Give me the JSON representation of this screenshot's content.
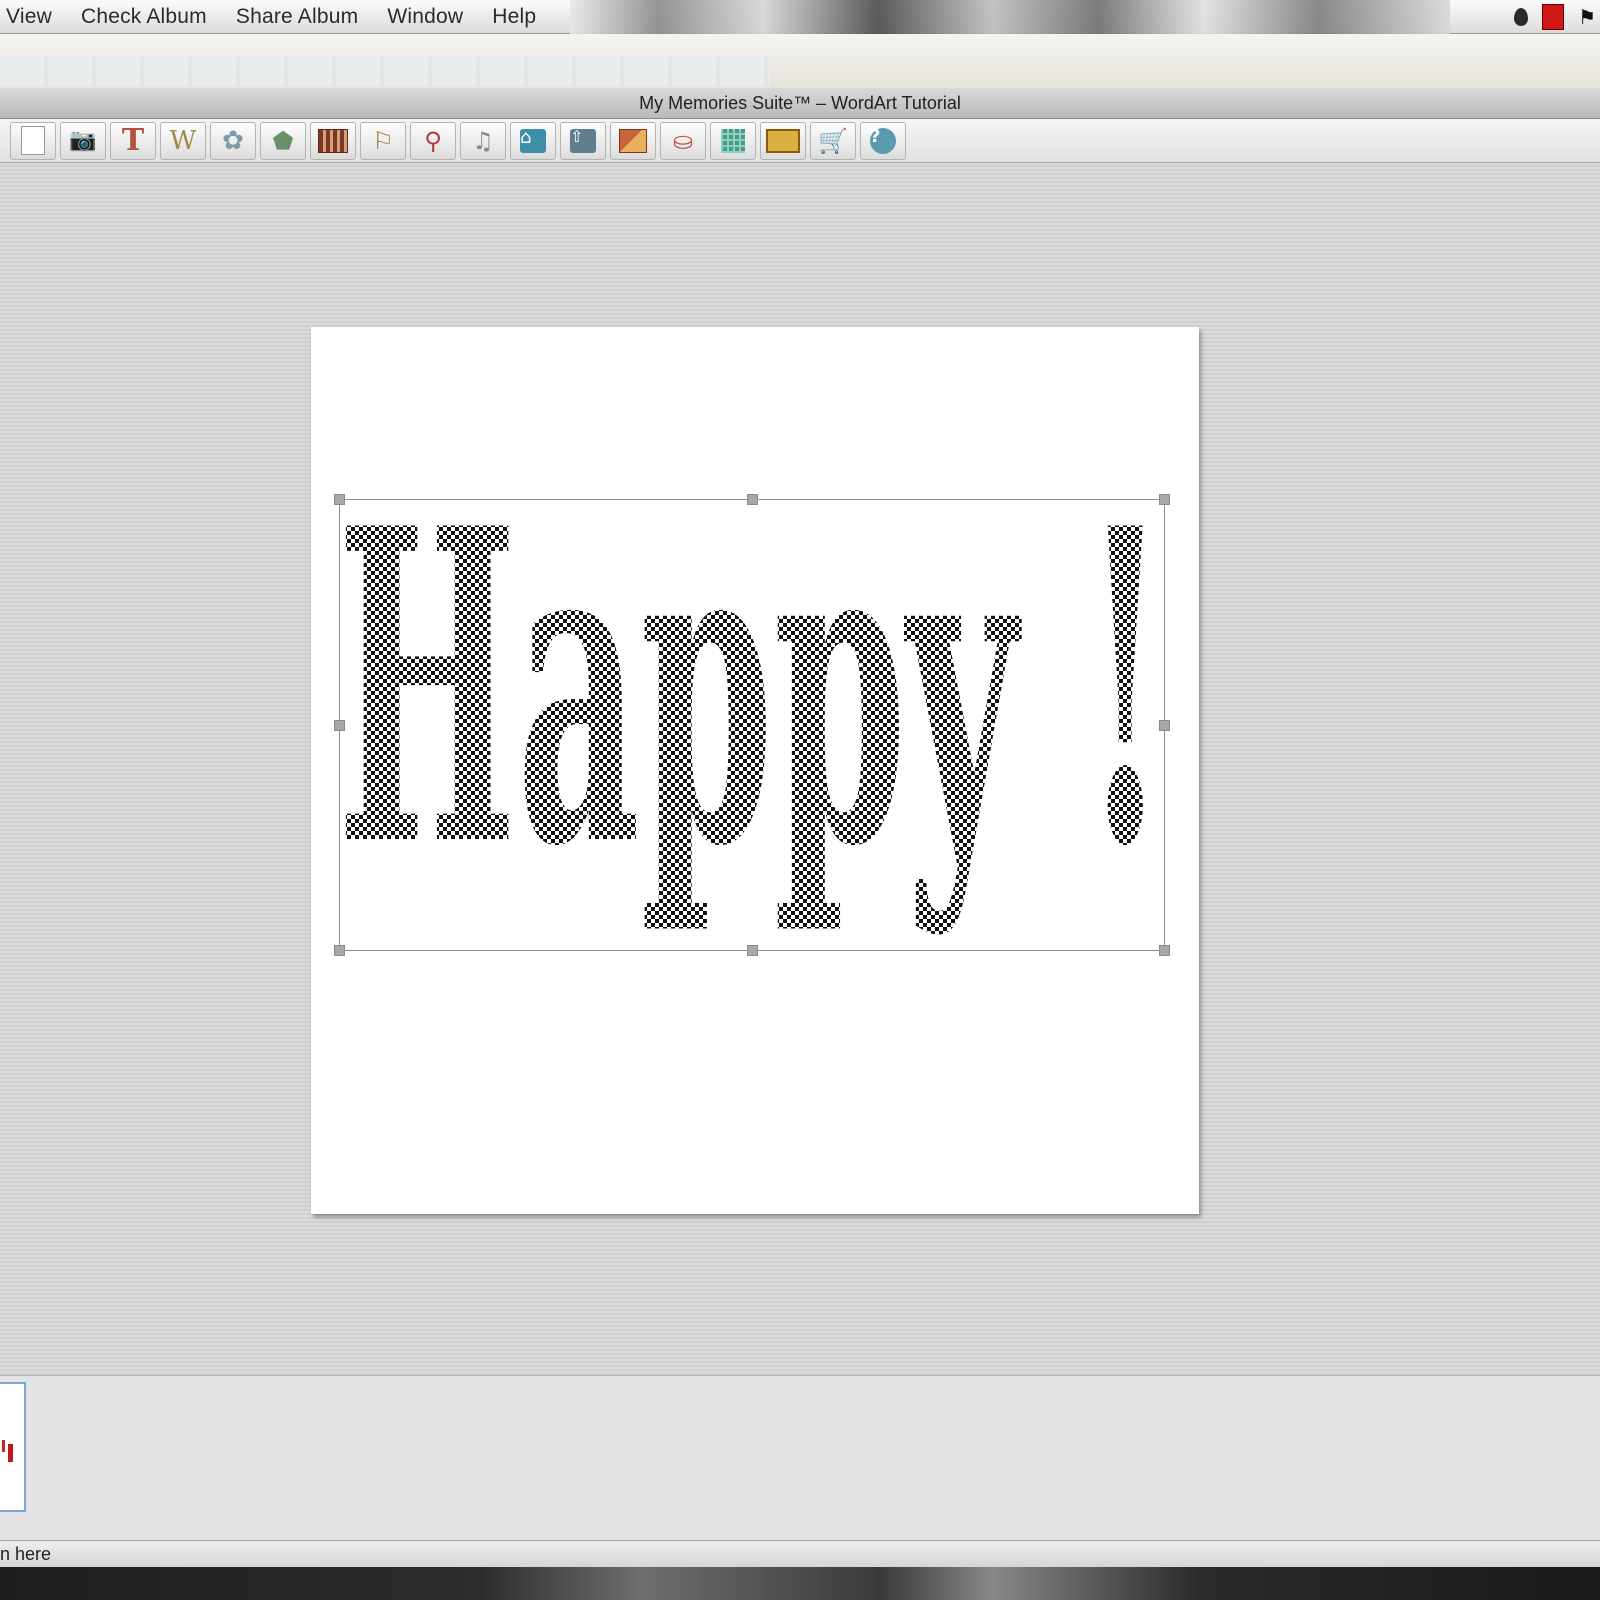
{
  "menubar": {
    "items": [
      "View",
      "Check Album",
      "Share Album",
      "Window",
      "Help"
    ]
  },
  "window": {
    "title": "My Memories Suite™ – WordArt Tutorial"
  },
  "toolbar": {
    "buttons": [
      {
        "name": "new-page",
        "icon": "page-icon"
      },
      {
        "name": "add-photo",
        "icon": "camera-icon"
      },
      {
        "name": "add-text",
        "icon": "text-icon",
        "glyph": "T"
      },
      {
        "name": "add-wordart",
        "icon": "wordart-icon",
        "glyph": "W"
      },
      {
        "name": "add-embellishment",
        "icon": "flower-icon",
        "glyph": "✿"
      },
      {
        "name": "add-shape",
        "icon": "shape-icon"
      },
      {
        "name": "add-video",
        "icon": "film-icon"
      },
      {
        "name": "add-flag",
        "icon": "flag-icon"
      },
      {
        "name": "add-link",
        "icon": "link-icon"
      },
      {
        "name": "add-music",
        "icon": "music-icon",
        "glyph": "♫"
      },
      {
        "name": "home",
        "icon": "home-icon"
      },
      {
        "name": "upload",
        "icon": "upload-icon"
      },
      {
        "name": "layers",
        "icon": "layers-icon"
      },
      {
        "name": "stamp",
        "icon": "stamp-icon"
      },
      {
        "name": "grid",
        "icon": "grid-icon"
      },
      {
        "name": "ticket",
        "icon": "ticket-icon"
      },
      {
        "name": "store",
        "icon": "cart-icon"
      },
      {
        "name": "help",
        "icon": "help-icon",
        "glyph": "?"
      }
    ]
  },
  "canvas": {
    "wordart_text": "Happy !",
    "fill_pattern": "black-white checkerboard"
  },
  "status": {
    "text": "n here"
  },
  "colors": {
    "selection_handle": "#a8a8a8",
    "thumb_border": "#7aa7d4",
    "tray_red": "#d01818"
  }
}
